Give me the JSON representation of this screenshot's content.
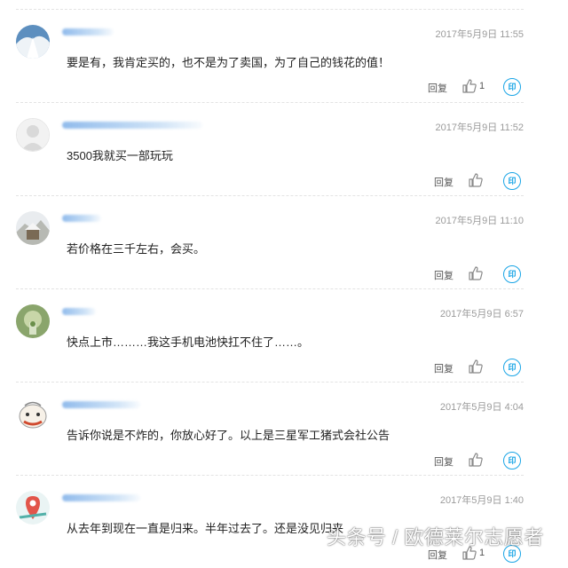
{
  "comments": [
    {
      "time": "2017年5月9日 11:55",
      "text": "要是有，我肯定买的，也不是为了卖国，为了自己的钱花的值！",
      "reply": "回复",
      "likes": "1",
      "share": "印"
    },
    {
      "time": "2017年5月9日 11:52",
      "text": "3500我就买一部玩玩",
      "reply": "回复",
      "likes": "",
      "share": "印"
    },
    {
      "time": "2017年5月9日 11:10",
      "text": "若价格在三千左右，会买。",
      "reply": "回复",
      "likes": "",
      "share": "印"
    },
    {
      "time": "2017年5月9日 6:57",
      "text": "快点上市………我这手机电池快扛不住了……。",
      "reply": "回复",
      "likes": "",
      "share": "印"
    },
    {
      "time": "2017年5月9日 4:04",
      "text": "告诉你说是不炸的，你放心好了。以上是三星军工猪式会社公告",
      "reply": "回复",
      "likes": "",
      "share": "印"
    },
    {
      "time": "2017年5月9日 1:40",
      "text": "从去年到现在一直是归来。半年过去了。还是没见归来",
      "reply": "回复",
      "likes": "1",
      "share": "印"
    }
  ],
  "watermark": "头条号 / 欧德莱尔志愿者",
  "colors": {
    "accent": "#1aa5e6",
    "timestamp": "#9b9b9b",
    "divider": "#e3e3e3"
  },
  "icons": [
    "avatar-icon",
    "thumbs-up-icon",
    "share-icon"
  ]
}
